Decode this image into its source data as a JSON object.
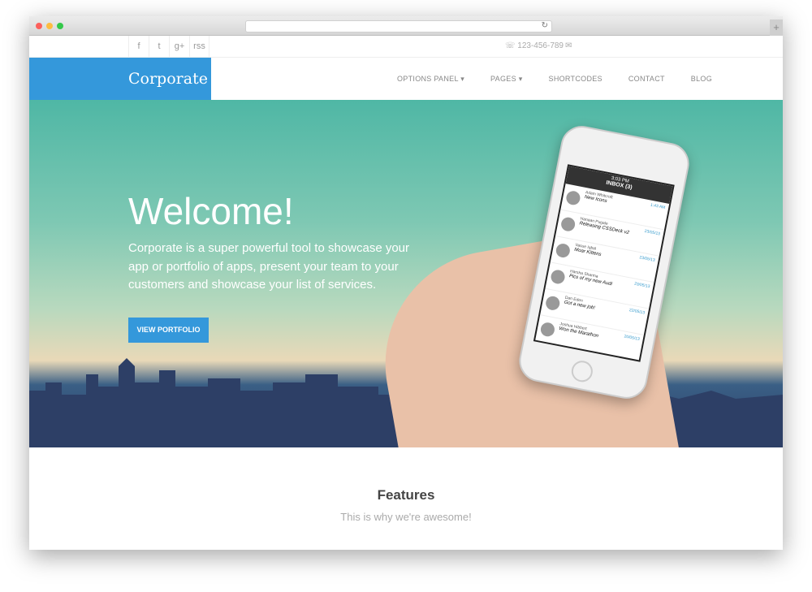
{
  "browser": {
    "reload_icon": "reload-icon",
    "new_tab": "+"
  },
  "topbar": {
    "social": [
      "f",
      "t",
      "g+",
      "rss"
    ],
    "phone": "☏ 123-456-789",
    "email_icon": "✉"
  },
  "nav": {
    "logo": "Corporate",
    "items": [
      "OPTIONS PANEL ▾",
      "PAGES ▾",
      "SHORTCODES",
      "CONTACT",
      "BLOG"
    ]
  },
  "hero": {
    "title": "Welcome!",
    "text": "Corporate is a super powerful tool to showcase your app or portfolio of apps, present your team to your customers and showcase your list of services.",
    "button": "VIEW PORTFOLIO",
    "phone": {
      "time": "3:03 PM",
      "title": "INBOX (3)",
      "messages": [
        {
          "from": "Adam Whitcroft",
          "subject": "New Icons",
          "time": "1:43 AM"
        },
        {
          "from": "Hanaan Pugale",
          "subject": "Releasing CSSDeck v2",
          "time": "23/05/13"
        },
        {
          "from": "Vasue Iqbal",
          "subject": "Moar Kittens",
          "time": "23/05/13"
        },
        {
          "from": "Harsha Sharma",
          "subject": "Pics of my new Audi",
          "time": "23/05/13"
        },
        {
          "from": "Dan Eden",
          "subject": "Got a new job!",
          "time": "22/05/13"
        },
        {
          "from": "Joshua Hibbert",
          "subject": "Won the Marathon",
          "time": "20/05/13"
        }
      ]
    }
  },
  "features": {
    "title": "Features",
    "subtitle": "This is why we're awesome!"
  },
  "colors": {
    "accent": "#3498db"
  }
}
